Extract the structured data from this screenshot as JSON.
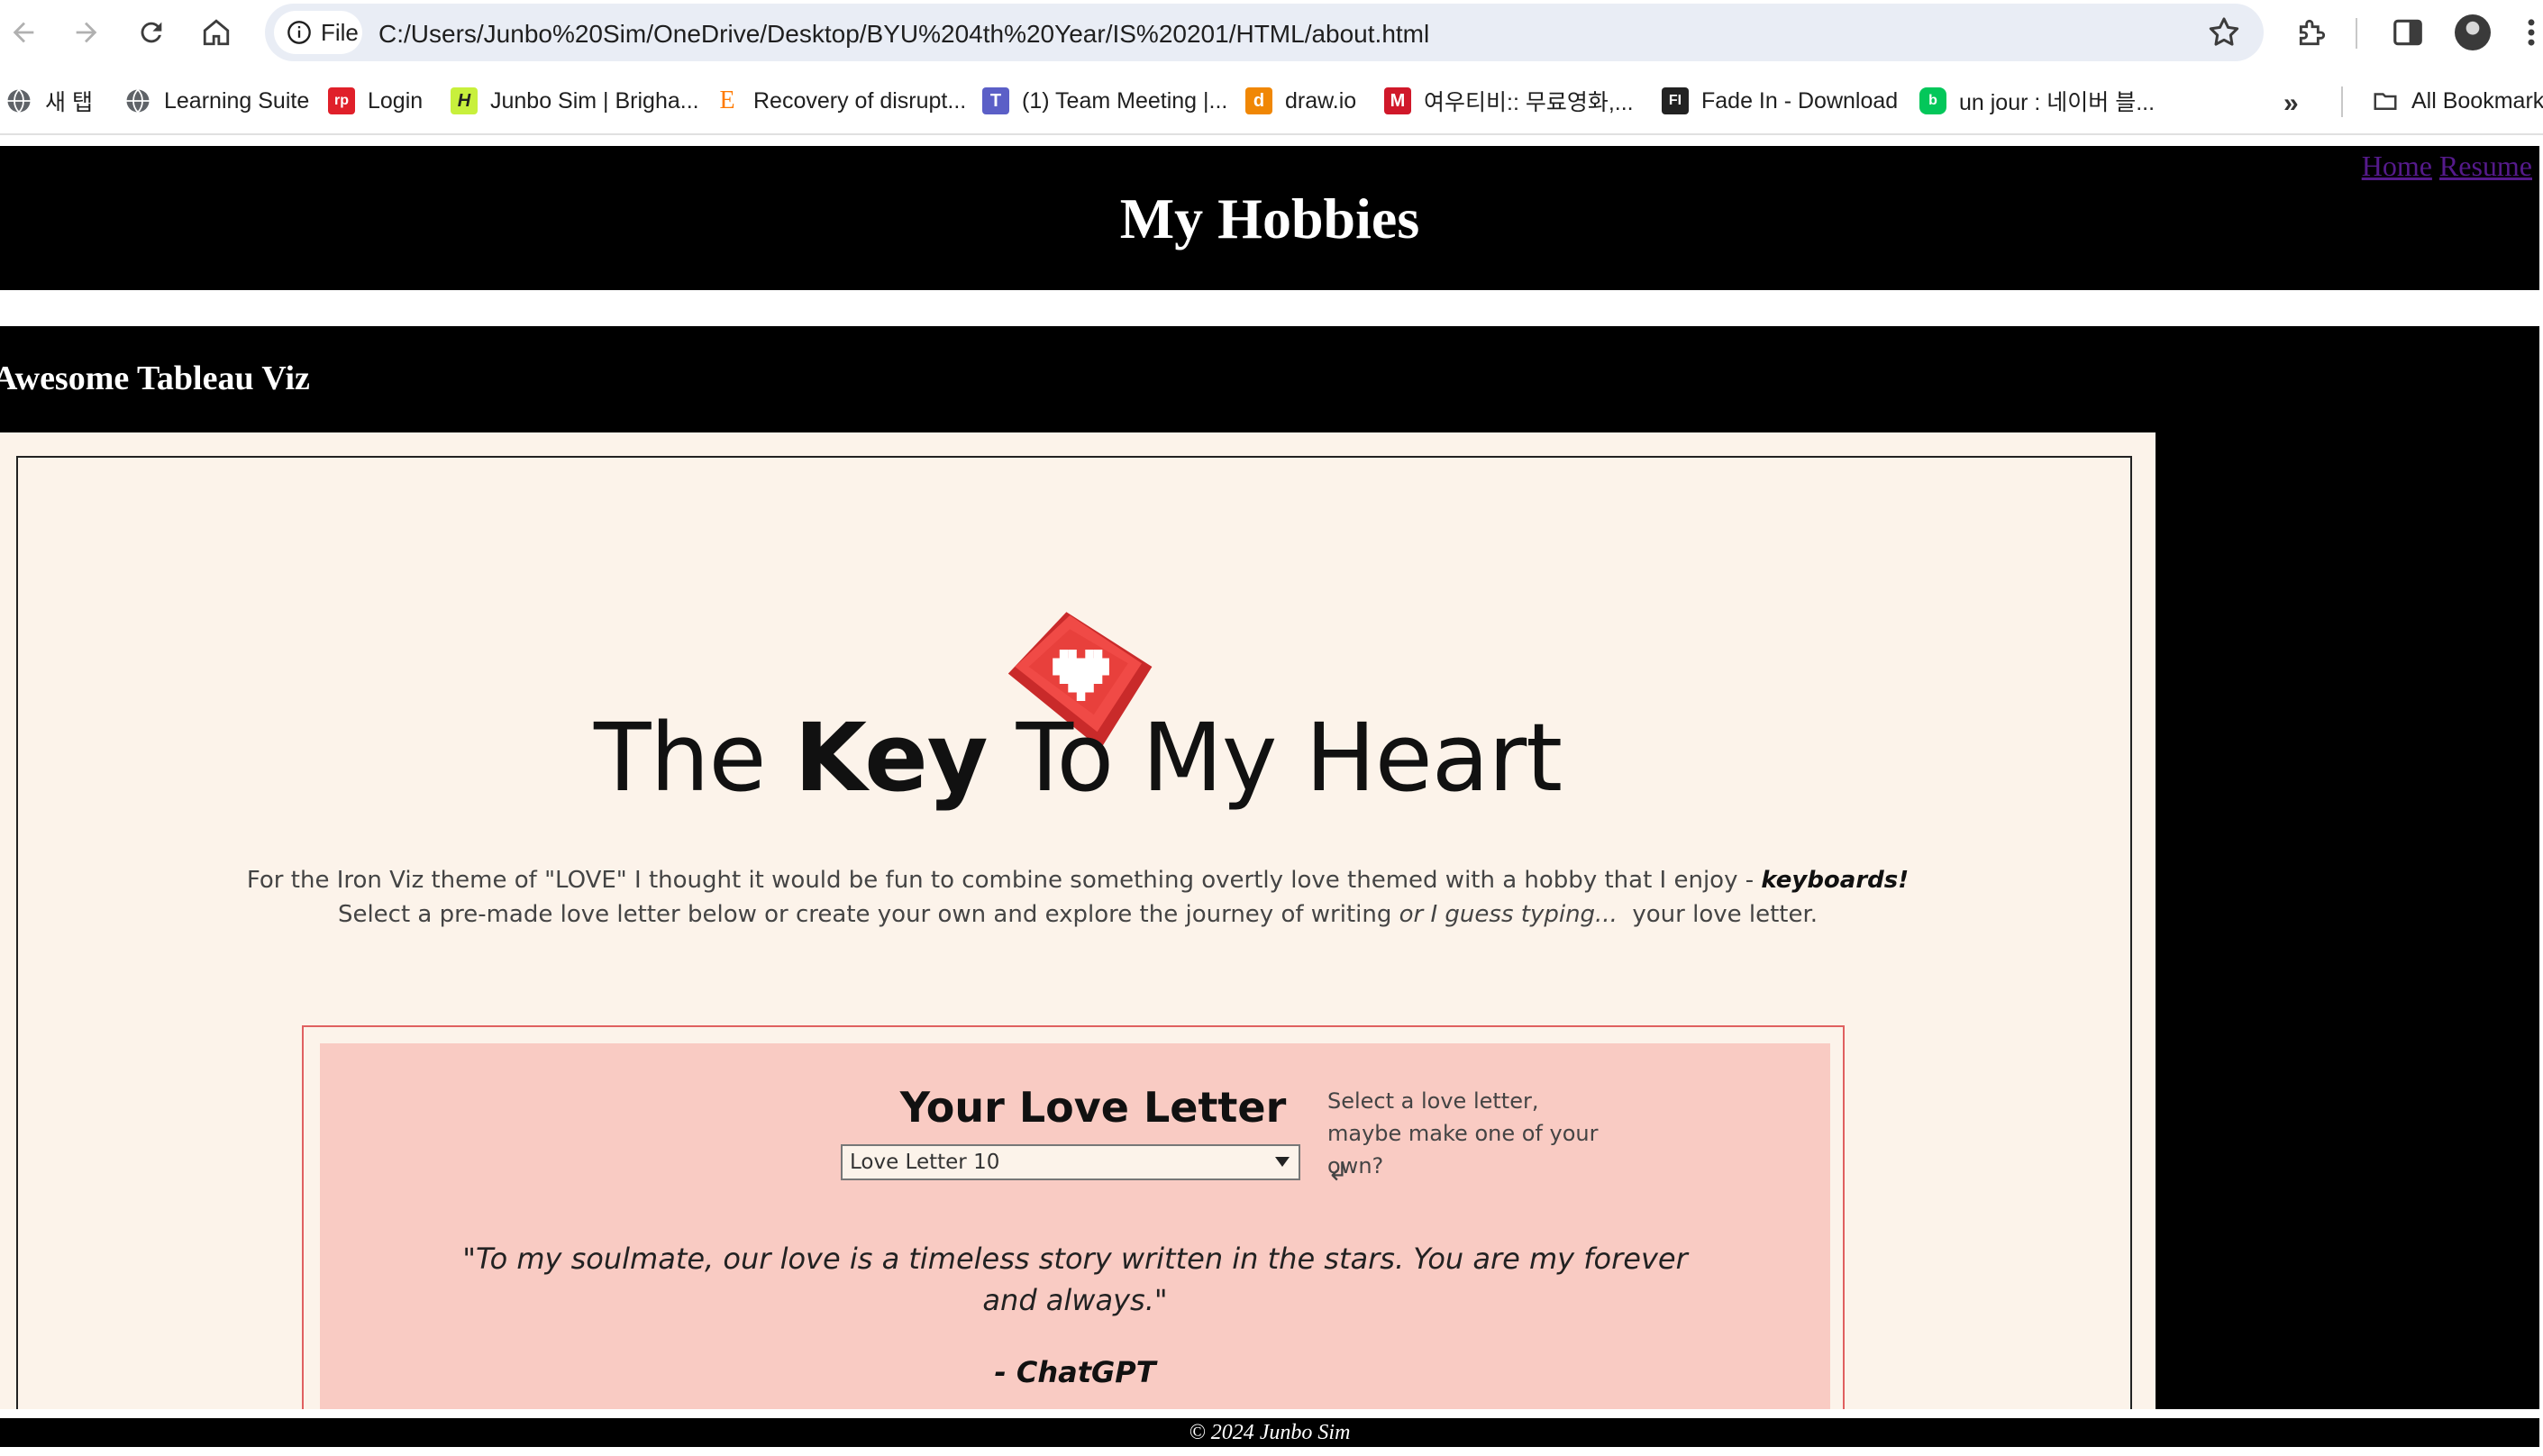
{
  "browser": {
    "site_chip": "File",
    "url": "C:/Users/Junbo%20Sim/OneDrive/Desktop/BYU%204th%20Year/IS%20201/HTML/about.html"
  },
  "bookmarks": [
    {
      "label": "새 탭",
      "icon": "globe-icon"
    },
    {
      "label": "Learning Suite",
      "icon": "globe-icon"
    },
    {
      "label": "Login",
      "icon": "rp-icon",
      "badge": "rp",
      "color": "#e0202a"
    },
    {
      "label": "Junbo Sim | Brigha...",
      "icon": "h-icon",
      "badge": "H",
      "color": "#c8f03c"
    },
    {
      "label": "Recovery of disrupt...",
      "icon": "e-icon",
      "badge": "E",
      "color": "#ff7a00"
    },
    {
      "label": "(1) Team Meeting |...",
      "icon": "teams-icon",
      "badge": "T",
      "color": "#5b5fc7"
    },
    {
      "label": "draw.io",
      "icon": "drawio-icon",
      "badge": "d",
      "color": "#f08705"
    },
    {
      "label": "여우티비:: 무료영화,...",
      "icon": "fox-icon",
      "badge": "M",
      "color": "#d0182a"
    },
    {
      "label": "Fade In - Download",
      "icon": "fadein-icon",
      "badge": "FI",
      "color": "#222222"
    },
    {
      "label": "un jour : 네이버 블...",
      "icon": "naver-blog-icon",
      "badge": "b",
      "color": "#03c75a"
    }
  ],
  "all_bookmarks": "All Bookmarks",
  "page": {
    "title": "My Hobbies",
    "nav": {
      "home": "Home",
      "resume": "Resume"
    },
    "section_title": "Awesome Tableau Viz",
    "footer": "© 2024 Junbo Sim"
  },
  "viz": {
    "heading_pre": "The ",
    "heading_bold": "Key",
    "heading_post": " To My Heart",
    "intro_line1": "For the Iron Viz theme of \"LOVE\" I thought it would be fun to combine something overtly love themed with a hobby that I enjoy - ",
    "intro_line1_emph": "keyboards!",
    "intro_line2_pre": "Select a pre-made love letter below or create your own and explore the journey of writing ",
    "intro_line2_it": "or I guess typing...",
    "intro_line2_post": "  your love letter.",
    "letter_title": "Your Love Letter",
    "selected_letter": "Love Letter 10",
    "hint": "Select a love letter, maybe make one of your own?",
    "hint_arrow": "↲",
    "quote": "\"To my soulmate, our love is a timeless story written in the stars. You are my forever and always.\"",
    "author": "- ChatGPT"
  },
  "colors": {
    "page_bg": "#000000",
    "viz_bg": "#fcf3ea",
    "letter_bg": "#f9cbc3",
    "letter_border": "#e06060",
    "link": "#551a8b",
    "keycap": "#e83a3a"
  }
}
